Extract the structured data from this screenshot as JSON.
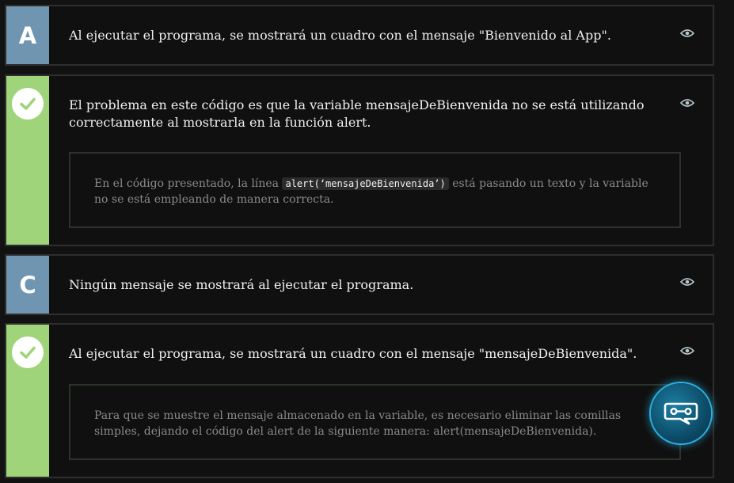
{
  "options": [
    {
      "badge": "A",
      "text": "Al ejecutar el programa, se mostrará un cuadro con el mensaje \"Bienvenido al App\"."
    },
    {
      "text": "El problema en este código es que la variable mensajeDeBienvenida no se está utilizando correctamente al mostrarla en la función alert.",
      "explanation_before": "En el código presentado, la línea ",
      "explanation_code": "alert(‘mensajeDeBienvenida’)",
      "explanation_after": " está pasando un texto y la variable no se está empleando de manera correcta."
    },
    {
      "badge": "C",
      "text": "Ningún mensaje se mostrará al ejecutar el programa."
    },
    {
      "text": "Al ejecutar el programa, se mostrará un cuadro con el mensaje \"mensajeDeBienvenida\".",
      "explanation": "Para que se muestre el mensaje almacenado en la variable, es necesario eliminar las comillas simples, dejando el código del alert de la siguiente manera: alert(mensajeDeBienvenida)."
    }
  ],
  "colors": {
    "badge_letter": "#6f95b0",
    "badge_correct": "#9fd47a",
    "chat_accent": "#2ab0e0"
  },
  "icons": {
    "toggle": "eye-icon",
    "correct": "check-icon",
    "chat": "chat-bot-icon"
  }
}
